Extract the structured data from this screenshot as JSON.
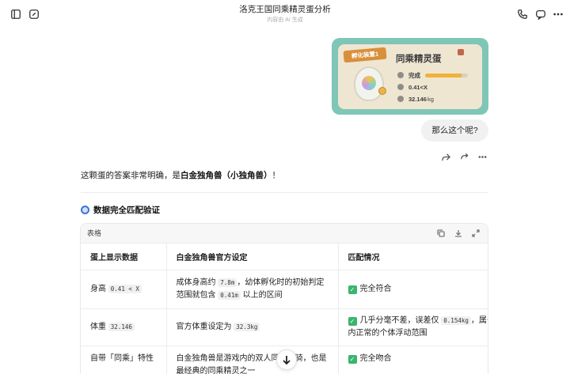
{
  "header": {
    "title": "洛克王国同乘精灵蛋分析",
    "subtitle": "内容由 AI 生成"
  },
  "image_card": {
    "badge": "孵化装置1",
    "egg_name": "同乘精灵蛋",
    "status_label": "完成",
    "progress": 0.85,
    "height_value": "0.41<X",
    "weight_value": "32.146",
    "weight_unit": "kg"
  },
  "user_message": "那么这个呢?",
  "answer": {
    "prefix": "这颗蛋的答案非常明确，是",
    "highlight": "白金独角兽（小独角兽）",
    "suffix": "！"
  },
  "section": {
    "title": "数据完全匹配验证"
  },
  "table": {
    "label": "表格",
    "headers": [
      "蛋上显示数据",
      "白金独角兽官方设定",
      "匹配情况"
    ],
    "rows": [
      {
        "c1_text": "身高",
        "c1_code": "0.41 < X",
        "c2_a": "成体身高约",
        "c2_code1": "7.8m",
        "c2_b": "，幼体孵化时的初始判定范围就包含",
        "c2_code2": "0.41m",
        "c2_c": "以上的区间",
        "c3": "完全符合"
      },
      {
        "c1_text": "体重",
        "c1_code": "32.146",
        "c2_a": "官方体重设定为",
        "c2_code1": "32.3kg",
        "c3_a": "几乎分毫不差，误差仅",
        "c3_code": "0.154kg",
        "c3_b": "，属于游戏内正常的个体浮动范围"
      },
      {
        "c1_text": "自带「同乘」特性",
        "c2": "白金独角兽是游戏内的双人同乘坐骑，也是最经典的同乘精灵之一",
        "c3": "完全吻合"
      }
    ]
  },
  "colors": {
    "accent_green": "#3ab56e",
    "card_bg": "#7fc6b6",
    "badge": "#d9903a"
  }
}
